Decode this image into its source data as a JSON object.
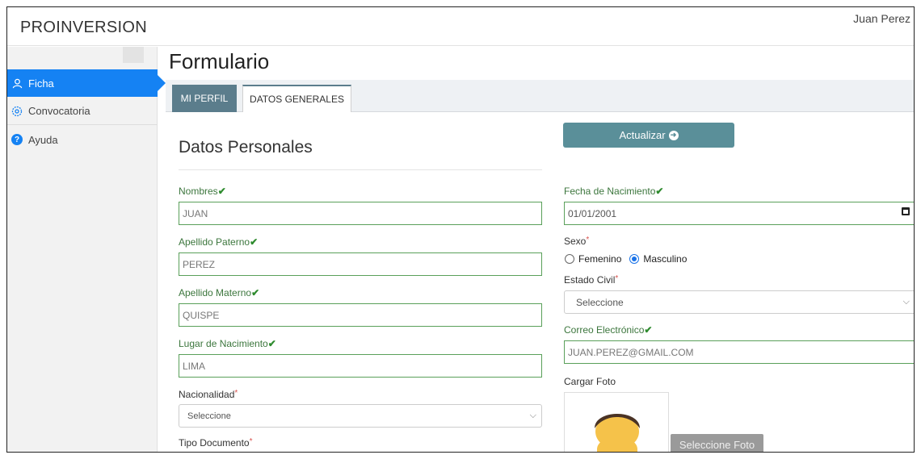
{
  "app": {
    "brand": "PROINVERSION",
    "user_name": "Juan Perez"
  },
  "sidebar": {
    "items": [
      {
        "label": "Ficha",
        "icon": "user-icon",
        "active": true
      },
      {
        "label": "Convocatoria",
        "icon": "gear-icon",
        "active": false
      },
      {
        "label": "Ayuda",
        "icon": "help-icon",
        "active": false
      }
    ]
  },
  "page": {
    "title": "Formulario"
  },
  "tabs": [
    {
      "label": "MI PERFIL",
      "active": false
    },
    {
      "label": "DATOS GENERALES",
      "active": true
    }
  ],
  "section": {
    "title": "Datos Personales"
  },
  "actions": {
    "update_label": "Actualizar",
    "update_icon": "arrow-circle-right-icon",
    "select_photo_label": "Seleccione Foto"
  },
  "form": {
    "nombres": {
      "label": "Nombres",
      "value": "JUAN"
    },
    "apellido_paterno": {
      "label": "Apellido Paterno",
      "value": "PEREZ"
    },
    "apellido_materno": {
      "label": "Apellido Materno",
      "value": "QUISPE"
    },
    "lugar_nacimiento": {
      "label": "Lugar de Nacimiento",
      "value": "LIMA"
    },
    "nacionalidad": {
      "label": "Nacionalidad",
      "required": "*",
      "value": "Seleccione"
    },
    "tipo_documento": {
      "label": "Tipo Documento",
      "required": "*"
    },
    "fecha_nacimiento": {
      "label": "Fecha de Nacimiento",
      "value": "01/01/2001"
    },
    "sexo": {
      "label": "Sexo",
      "required": "*",
      "options": [
        "Femenino",
        "Masculino"
      ],
      "selected": "Masculino"
    },
    "estado_civil": {
      "label": "Estado Civil",
      "required": "*",
      "value": "Seleccione"
    },
    "correo": {
      "label": "Correo Electrónico",
      "value": "JUAN.PEREZ@GMAIL.COM"
    },
    "foto": {
      "label": "Cargar Foto"
    }
  },
  "colors": {
    "accent": "#1582f3",
    "tab_active": "#5b7d8c",
    "button": "#5a8f99",
    "valid": "#5aa05a"
  }
}
